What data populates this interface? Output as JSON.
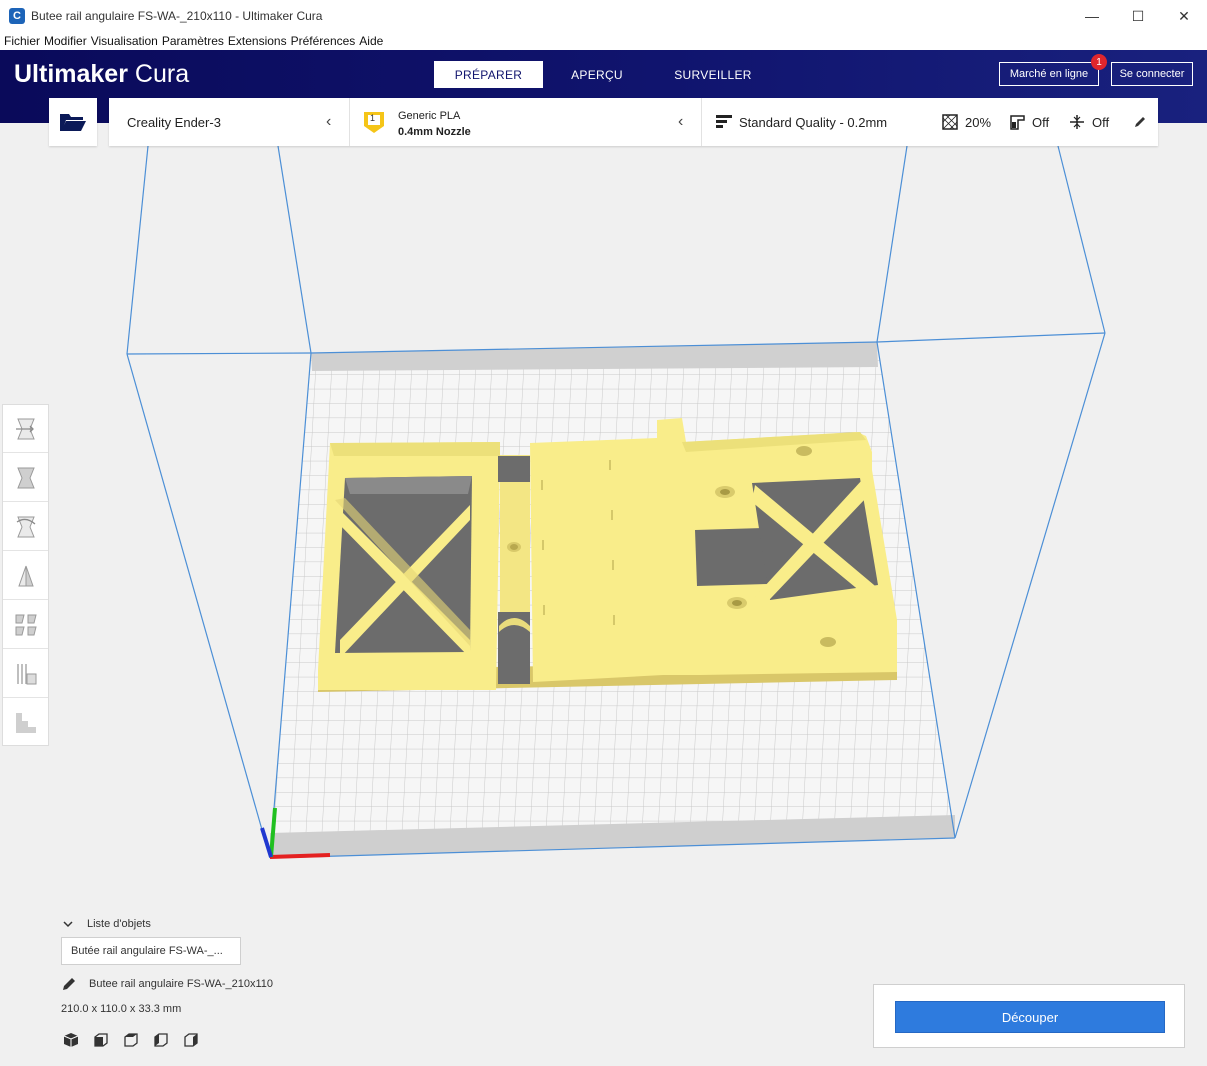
{
  "window": {
    "title": "Butee rail angulaire FS-WA-_210x110 - Ultimaker Cura",
    "app_icon": "C",
    "minimize": "—",
    "maximize": "☐",
    "close": "✕"
  },
  "menu": [
    "Fichier",
    "Modifier",
    "Visualisation",
    "Paramètres",
    "Extensions",
    "Préférences",
    "Aide"
  ],
  "header": {
    "brand_bold": "Ultimaker",
    "brand_light": "Cura",
    "tabs": [
      {
        "label": "PRÉPARER",
        "active": true
      },
      {
        "label": "APERÇU",
        "active": false
      },
      {
        "label": "SURVEILLER",
        "active": false
      }
    ],
    "marketplace_label": "Marché en ligne",
    "marketplace_badge": "1",
    "signin_label": "Se connecter"
  },
  "stage": {
    "printer": "Creality Ender-3",
    "material_badge": "1",
    "material_name": "Generic PLA",
    "nozzle": "0.4mm Nozzle",
    "profile": "Standard Quality - 0.2mm",
    "infill": "20%",
    "support": "Off",
    "adhesion": "Off"
  },
  "toolbar": {
    "tools": [
      "move-tool",
      "scale-tool",
      "rotate-tool",
      "mirror-tool",
      "per-model-settings-tool",
      "support-blocker-tool",
      "layer-tool"
    ]
  },
  "objects": {
    "header": "Liste d'objets",
    "list_item": "Butée rail angulaire FS-WA-_...",
    "selected_name": "Butee rail angulaire FS-WA-_210x110",
    "dimensions": "210.0 x 110.0 x 33.3 mm"
  },
  "slice": {
    "button_label": "Découper"
  },
  "colors": {
    "header_bg": "#10146e",
    "accent_blue": "#2e7bde",
    "model_yellow": "#f9ed8a",
    "badge_red": "#e0262d"
  }
}
